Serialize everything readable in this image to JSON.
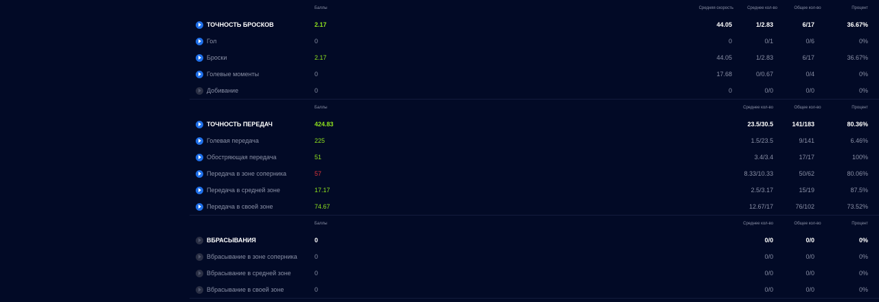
{
  "sections": [
    {
      "headers": {
        "score": "Баллы",
        "col1": "Средняя скорость",
        "col2": "Среднее кол-во",
        "col3": "Общее кол-во",
        "col4": "Процент"
      },
      "main": {
        "name": "ТОЧНОСТЬ БРОСКОВ",
        "score": "2.17",
        "col1": "44.05",
        "col2": "1/2.83",
        "col3": "6/17",
        "col4": "36.67%"
      },
      "rows": [
        {
          "name": "Гол",
          "score": "0",
          "col1": "0",
          "col2": "0/1",
          "col3": "0/6",
          "col4": "0%"
        },
        {
          "name": "Броски",
          "score": "2.17",
          "col1": "44.05",
          "col2": "1/2.83",
          "col3": "6/17",
          "col4": "36.67%"
        },
        {
          "name": "Голевые моменты",
          "score": "0",
          "col1": "17.68",
          "col2": "0/0.67",
          "col3": "0/4",
          "col4": "0%"
        },
        {
          "name": "Добивание",
          "score": "0",
          "col1": "0",
          "col2": "0/0",
          "col3": "0/0",
          "col4": "0%"
        }
      ]
    },
    {
      "headers": {
        "score": "Баллы",
        "col2": "Среднее кол-во",
        "col3": "Общее кол-во",
        "col4": "Процент"
      },
      "main": {
        "name": "ТОЧНОСТЬ ПЕРЕДАЧ",
        "score": "424.83",
        "col2": "23.5/30.5",
        "col3": "141/183",
        "col4": "80.36%"
      },
      "rows": [
        {
          "name": "Голевая передача",
          "score": "225",
          "col2": "1.5/23.5",
          "col3": "9/141",
          "col4": "6.46%"
        },
        {
          "name": "Обостряющая передача",
          "score": "51",
          "col2": "3.4/3.4",
          "col3": "17/17",
          "col4": "100%"
        },
        {
          "name": "Передача в зоне соперника",
          "score": "57",
          "col2": "8.33/10.33",
          "col3": "50/62",
          "col4": "80.06%"
        },
        {
          "name": "Передача в средней зоне",
          "score": "17.17",
          "col2": "2.5/3.17",
          "col3": "15/19",
          "col4": "87.5%"
        },
        {
          "name": "Передача в своей зоне",
          "score": "74.67",
          "col2": "12.67/17",
          "col3": "76/102",
          "col4": "73.52%"
        }
      ]
    },
    {
      "headers": {
        "score": "Баллы",
        "col2": "Среднее кол-во",
        "col3": "Общее кол-во",
        "col4": "Процент"
      },
      "main": {
        "name": "ВБРАСЫВАНИЯ",
        "score": "0",
        "col2": "0/0",
        "col3": "0/0",
        "col4": "0%"
      },
      "rows": [
        {
          "name": "Вбрасывание в зоне соперника",
          "score": "0",
          "col2": "0/0",
          "col3": "0/0",
          "col4": "0%"
        },
        {
          "name": "Вбрасывание в средней зоне",
          "score": "0",
          "col2": "0/0",
          "col3": "0/0",
          "col4": "0%"
        },
        {
          "name": "Вбрасывание в своей зоне",
          "score": "0",
          "col2": "0/0",
          "col3": "0/0",
          "col4": "0%"
        }
      ]
    }
  ]
}
